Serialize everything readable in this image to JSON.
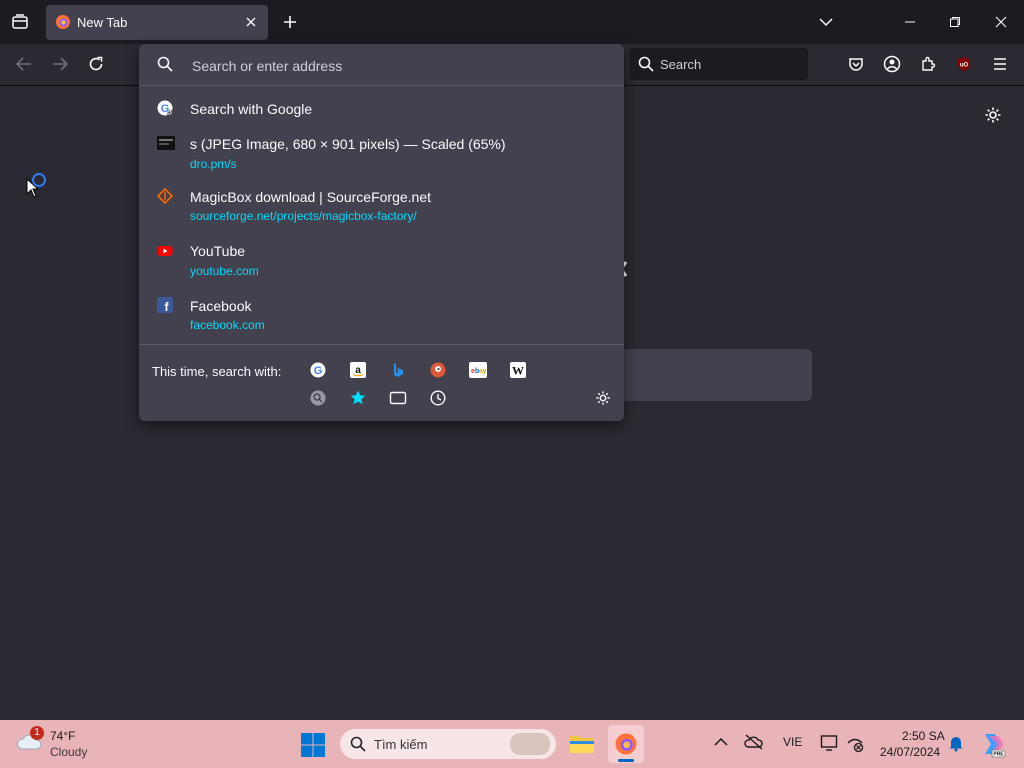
{
  "tabs": [
    {
      "title": "New Tab",
      "favicon": "firefox-icon"
    }
  ],
  "navbar": {
    "search_placeholder": "Search"
  },
  "urlbar": {
    "placeholder": "Search or enter address",
    "results": [
      {
        "icon": "google-icon",
        "title": "Search with Google",
        "url": ""
      },
      {
        "icon": "image-thumbnail-icon",
        "title": "s (JPEG Image, 680 × 901 pixels) — Scaled (65%)",
        "url": "dro.pm/s"
      },
      {
        "icon": "sourceforge-icon",
        "title": "MagicBox download | SourceForge.net",
        "url": "sourceforge.net/projects/magicbox-factory/"
      },
      {
        "icon": "youtube-icon",
        "title": "YouTube",
        "url": "youtube.com"
      },
      {
        "icon": "facebook-icon",
        "title": "Facebook",
        "url": "facebook.com"
      }
    ],
    "oneoff_label": "This time, search with:",
    "engines": [
      "google-icon",
      "amazon-icon",
      "bing-icon",
      "duckduckgo-icon",
      "ebay-icon",
      "wikipedia-icon",
      "search-history-icon",
      "bookmarks-star-icon",
      "tabs-icon",
      "history-clock-icon"
    ]
  },
  "taskbar": {
    "weather_temp": "74°F",
    "weather_condition": "Cloudy",
    "weather_badge": "1",
    "search_placeholder": "Tìm kiếm",
    "language": "VIE",
    "time": "2:50 SA",
    "date": "24/07/2024"
  },
  "colors": {
    "toolbar": "#2b2a33",
    "tabstrip": "#1c1b22",
    "panel": "#42414d",
    "url_text": "#00ddff",
    "taskbar": "#e8b4b8"
  }
}
